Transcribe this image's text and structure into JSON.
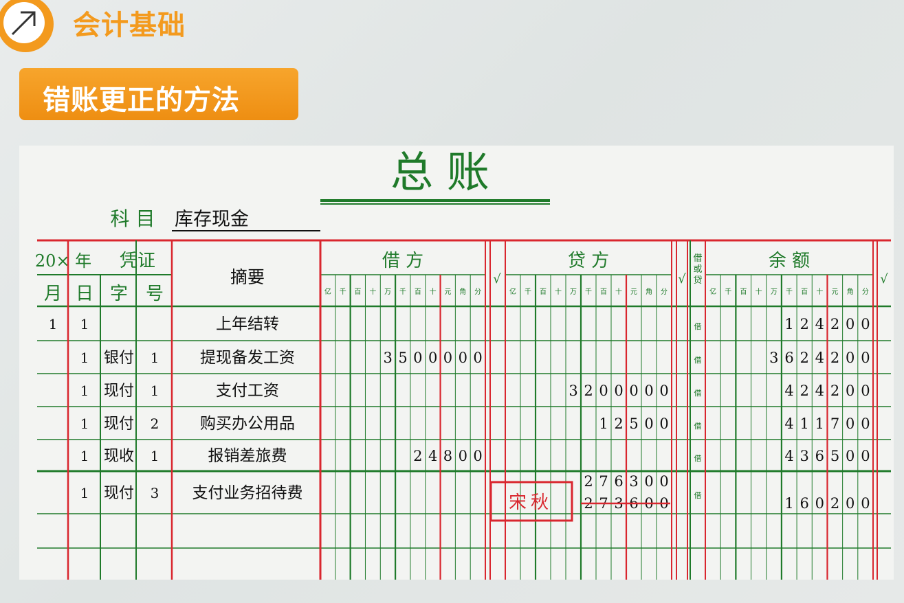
{
  "header": {
    "app_title": "会计基础",
    "section_title": "错账更正的方法",
    "logo_icon": "diagonal-arrow-icon",
    "accent_color": "#f39a1e"
  },
  "ledger": {
    "title": "总  账",
    "subject_label": "科  目",
    "subject_value": "库存现金",
    "headers": {
      "year": "20× 年",
      "voucher": "凭证",
      "month": "月",
      "day": "日",
      "voucher_type": "字",
      "voucher_no": "号",
      "summary": "摘要",
      "debit": "借  方",
      "credit": "贷  方",
      "check": "√",
      "dir": "借或贷",
      "balance": "余  额"
    },
    "digit_units": [
      "亿",
      "千",
      "百",
      "十",
      "万",
      "千",
      "百",
      "十",
      "元",
      "角",
      "分"
    ],
    "rows": [
      {
        "month": "1",
        "day": "1",
        "type": "",
        "no": "",
        "summary": "上年结转",
        "debit": "",
        "credit": "",
        "dir": "借",
        "balance": "124200"
      },
      {
        "month": "",
        "day": "1",
        "type": "银付",
        "no": "1",
        "summary": "提现备发工资",
        "debit": "3500000",
        "credit": "",
        "dir": "借",
        "balance": "3624200"
      },
      {
        "month": "",
        "day": "1",
        "type": "现付",
        "no": "1",
        "summary": "支付工资",
        "debit": "",
        "credit": "3200000",
        "dir": "借",
        "balance": "424200"
      },
      {
        "month": "",
        "day": "1",
        "type": "现付",
        "no": "2",
        "summary": "购买办公用品",
        "debit": "",
        "credit": "12500",
        "dir": "借",
        "balance": "411700"
      },
      {
        "month": "",
        "day": "1",
        "type": "现收",
        "no": "1",
        "summary": "报销差旅费",
        "debit": "24800",
        "credit": "",
        "dir": "借",
        "balance": "436500"
      },
      {
        "month": "",
        "day": "1",
        "type": "现付",
        "no": "3",
        "summary": "支付业务招待费",
        "debit": "",
        "credit": "273600",
        "credit_correction": "276300",
        "dir": "借",
        "balance": "160200"
      }
    ],
    "stamp_text": "宋秋",
    "colors": {
      "red": "#d9262e",
      "green": "#1f7a2a",
      "ink": "#111111"
    }
  }
}
